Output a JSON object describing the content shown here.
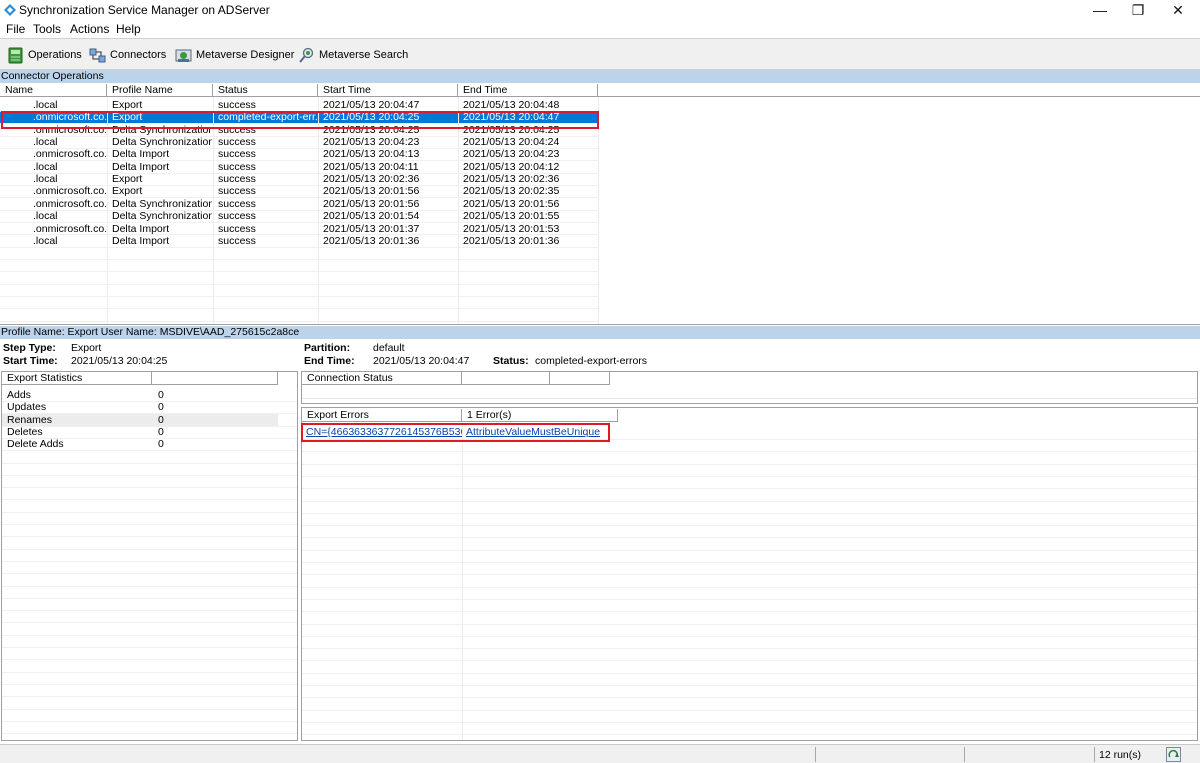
{
  "window": {
    "title": "Synchronization Service Manager on ADServer",
    "minimize": "—",
    "restore": "❐",
    "close": "✕"
  },
  "menu": [
    "File",
    "Tools",
    "Actions",
    "Help"
  ],
  "toolbar": {
    "operations": "Operations",
    "connectors": "Connectors",
    "metaverse_designer": "Metaverse Designer",
    "metaverse_search": "Metaverse Search"
  },
  "connector_operations": {
    "header": "Connector Operations",
    "columns": [
      "Name",
      "Profile Name",
      "Status",
      "Start Time",
      "End Time"
    ],
    "rows": [
      {
        "name": ".local",
        "profile": "Export",
        "status": "success",
        "start": "2021/05/13 20:04:47",
        "end": "2021/05/13 20:04:48"
      },
      {
        "name": ".onmicrosoft.co...",
        "profile": "Export",
        "status": "completed-export-err...",
        "start": "2021/05/13 20:04:25",
        "end": "2021/05/13 20:04:47"
      },
      {
        "name": ".onmicrosoft.co...",
        "profile": "Delta Synchronization",
        "status": "success",
        "start": "2021/05/13 20:04:25",
        "end": "2021/05/13 20:04:25"
      },
      {
        "name": ".local",
        "profile": "Delta Synchronization",
        "status": "success",
        "start": "2021/05/13 20:04:23",
        "end": "2021/05/13 20:04:24"
      },
      {
        "name": ".onmicrosoft.co...",
        "profile": "Delta Import",
        "status": "success",
        "start": "2021/05/13 20:04:13",
        "end": "2021/05/13 20:04:23"
      },
      {
        "name": ".local",
        "profile": "Delta Import",
        "status": "success",
        "start": "2021/05/13 20:04:11",
        "end": "2021/05/13 20:04:12"
      },
      {
        "name": ".local",
        "profile": "Export",
        "status": "success",
        "start": "2021/05/13 20:02:36",
        "end": "2021/05/13 20:02:36"
      },
      {
        "name": ".onmicrosoft.co...",
        "profile": "Export",
        "status": "success",
        "start": "2021/05/13 20:01:56",
        "end": "2021/05/13 20:02:35"
      },
      {
        "name": ".onmicrosoft.co...",
        "profile": "Delta Synchronization",
        "status": "success",
        "start": "2021/05/13 20:01:56",
        "end": "2021/05/13 20:01:56"
      },
      {
        "name": ".local",
        "profile": "Delta Synchronization",
        "status": "success",
        "start": "2021/05/13 20:01:54",
        "end": "2021/05/13 20:01:55"
      },
      {
        "name": ".onmicrosoft.co...",
        "profile": "Delta Import",
        "status": "success",
        "start": "2021/05/13 20:01:37",
        "end": "2021/05/13 20:01:53"
      },
      {
        "name": ".local",
        "profile": "Delta Import",
        "status": "success",
        "start": "2021/05/13 20:01:36",
        "end": "2021/05/13 20:01:36"
      }
    ]
  },
  "details": {
    "header": "Profile Name: Export  User Name: MSDIVE\\AAD_275615c2a8ce",
    "step_type_label": "Step Type:",
    "step_type": "Export",
    "start_time_label": "Start Time:",
    "start_time": "2021/05/13 20:04:25",
    "partition_label": "Partition:",
    "partition": "default",
    "end_time_label": "End Time:",
    "end_time": "2021/05/13 20:04:47",
    "status_label": "Status:",
    "status": "completed-export-errors"
  },
  "export_statistics": {
    "header": "Export Statistics",
    "rows": [
      {
        "label": "Adds",
        "value": "0"
      },
      {
        "label": "Updates",
        "value": "0"
      },
      {
        "label": "Renames",
        "value": "0"
      },
      {
        "label": "Deletes",
        "value": "0"
      },
      {
        "label": "Delete Adds",
        "value": "0"
      }
    ]
  },
  "connection_status": {
    "header": "Connection Status"
  },
  "export_errors": {
    "header": "Export Errors",
    "count": "1 Error(s)",
    "dn": "CN={4663633637726145376B536...",
    "error": "AttributeValueMustBeUnique"
  },
  "statusbar": {
    "runs": "12 run(s)"
  },
  "colors": {
    "selection": "#0078d7",
    "section_header": "#bcd3ec",
    "highlight_box": "#e0182c",
    "link": "#0645ad"
  }
}
